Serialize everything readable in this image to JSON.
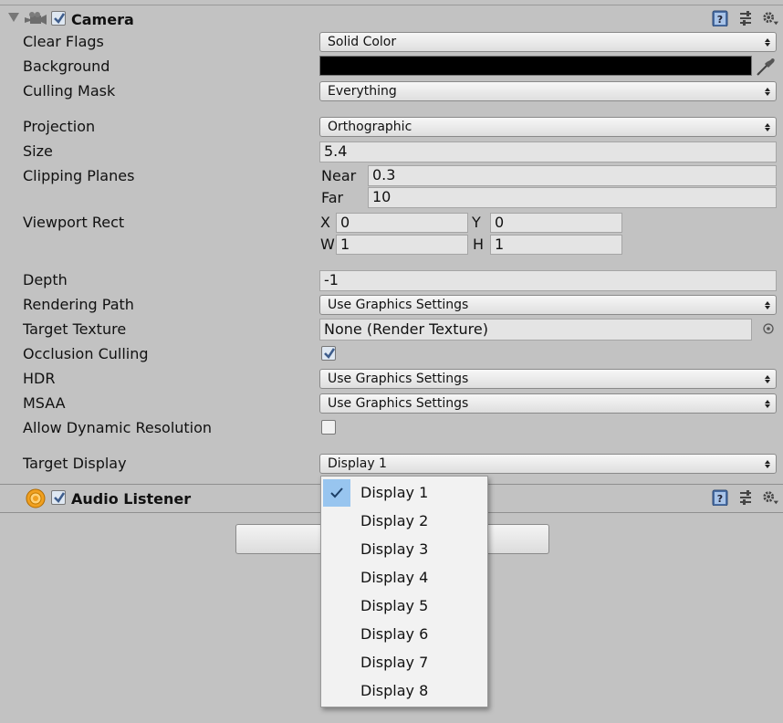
{
  "camera": {
    "title": "Camera",
    "enabled": true,
    "fields": {
      "clear_flags": {
        "label": "Clear Flags",
        "value": "Solid Color"
      },
      "background": {
        "label": "Background",
        "color": "#000000"
      },
      "culling_mask": {
        "label": "Culling Mask",
        "value": "Everything"
      },
      "projection": {
        "label": "Projection",
        "value": "Orthographic"
      },
      "size": {
        "label": "Size",
        "value": "5.4"
      },
      "clipping_planes": {
        "label": "Clipping Planes",
        "near_label": "Near",
        "near": "0.3",
        "far_label": "Far",
        "far": "10"
      },
      "viewport_rect": {
        "label": "Viewport Rect",
        "x_label": "X",
        "x": "0",
        "y_label": "Y",
        "y": "0",
        "w_label": "W",
        "w": "1",
        "h_label": "H",
        "h": "1"
      },
      "depth": {
        "label": "Depth",
        "value": "-1"
      },
      "rendering_path": {
        "label": "Rendering Path",
        "value": "Use Graphics Settings"
      },
      "target_texture": {
        "label": "Target Texture",
        "value": "None (Render Texture)"
      },
      "occlusion_culling": {
        "label": "Occlusion Culling",
        "checked": true
      },
      "hdr": {
        "label": "HDR",
        "value": "Use Graphics Settings"
      },
      "msaa": {
        "label": "MSAA",
        "value": "Use Graphics Settings"
      },
      "allow_dynamic_resolution": {
        "label": "Allow Dynamic Resolution",
        "checked": false
      },
      "target_display": {
        "label": "Target Display",
        "value": "Display 1"
      }
    }
  },
  "audio_listener": {
    "title": "Audio Listener",
    "enabled": true
  },
  "dropdown_menu": {
    "selected_index": 0,
    "items": [
      "Display 1",
      "Display 2",
      "Display 3",
      "Display 4",
      "Display 5",
      "Display 6",
      "Display 7",
      "Display 8"
    ]
  },
  "colors": {
    "panel_bg": "#c2c2c2",
    "selection": "#98c5ef",
    "checkbox_accent": "#3e5d8c"
  }
}
